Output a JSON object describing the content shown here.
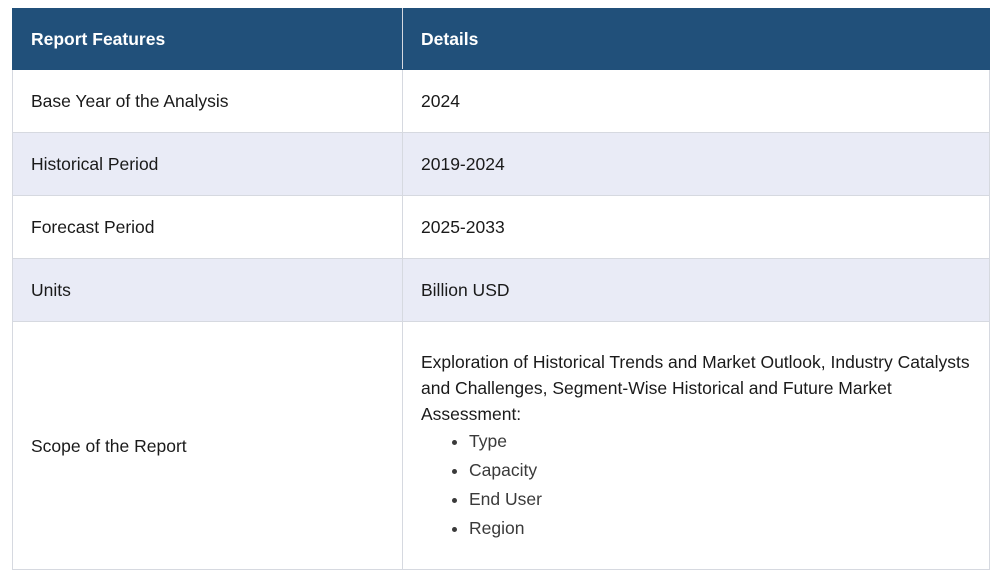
{
  "table": {
    "headers": [
      "Report Features",
      "Details"
    ],
    "rows": [
      {
        "feature": "Base Year of the Analysis",
        "details": "2024"
      },
      {
        "feature": "Historical Period",
        "details": "2019-2024"
      },
      {
        "feature": "Forecast Period",
        "details": "2025-2033"
      },
      {
        "feature": "Units",
        "details": "Billion USD"
      }
    ],
    "scope": {
      "feature": "Scope of the Report",
      "intro": "Exploration of Historical Trends and Market Outlook, Industry Catalysts and Challenges, Segment-Wise Historical and Future Market Assessment:",
      "items": [
        "Type",
        "Capacity",
        "End User",
        "Region"
      ]
    }
  },
  "colors": {
    "header_bg": "#21507a",
    "alt_row_bg": "#e9ebf6",
    "border": "#d6d9e0"
  }
}
